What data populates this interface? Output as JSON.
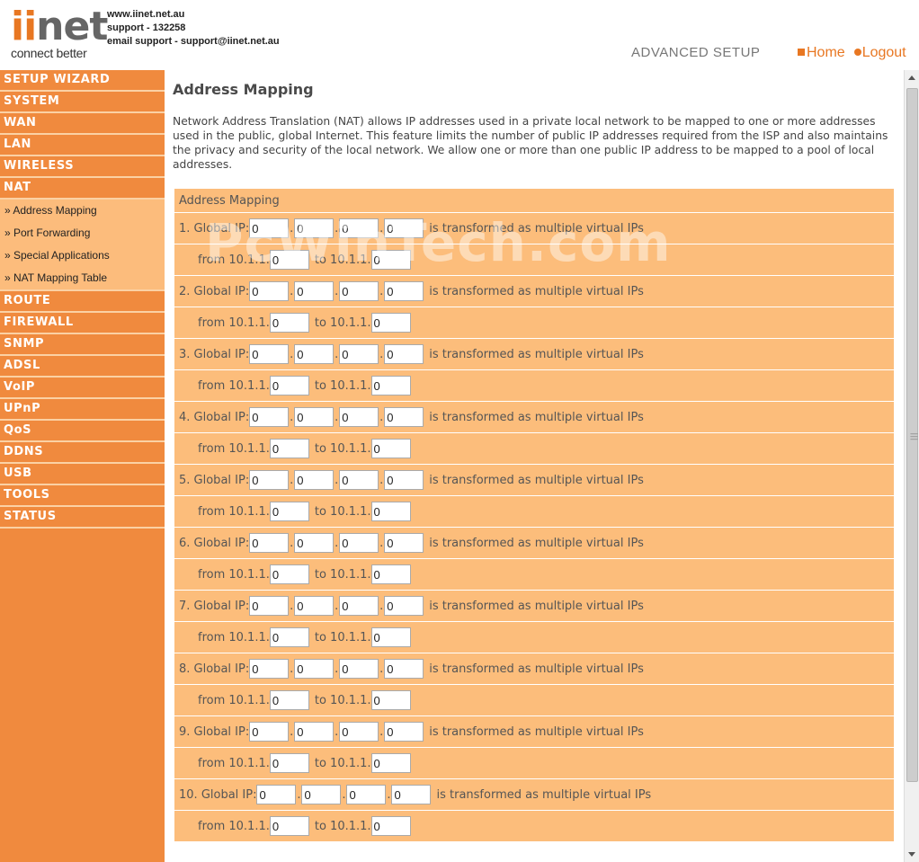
{
  "header": {
    "logo_main": "iinet",
    "logo_tagline": "connect better",
    "contact": [
      "www.iinet.net.au",
      "support - 132258",
      "email support - support@iinet.net.au"
    ],
    "section": "ADVANCED SETUP",
    "home_label": "Home",
    "logout_label": "Logout"
  },
  "sidebar": {
    "items_top": [
      "SETUP WIZARD",
      "SYSTEM",
      "WAN",
      "LAN",
      "WIRELESS",
      "NAT"
    ],
    "sub_items": [
      "» Address Mapping",
      "» Port Forwarding",
      "» Special Applications",
      "» NAT Mapping Table"
    ],
    "items_bottom": [
      "ROUTE",
      "FIREWALL",
      "SNMP",
      "ADSL",
      "VoIP",
      "UPnP",
      "QoS",
      "DDNS",
      "USB",
      "TOOLS",
      "STATUS"
    ]
  },
  "main": {
    "title": "Address Mapping",
    "description": "Network Address Translation (NAT) allows IP addresses used in a private local network to be mapped to one or more addresses used in the public, global Internet. This feature limits the number of public IP addresses required from the ISP and also maintains the privacy and security of the local network. We allow one or more than one public IP address to be mapped to a pool of local addresses.",
    "panel_title": "Address Mapping",
    "global_suffix": "Global IP:",
    "transformed_text": "is transformed as multiple virtual IPs",
    "from_label": "from 10.1.1.",
    "to_label": "to 10.1.1.",
    "mappings": [
      {
        "index": "1.",
        "global_ip": [
          "0",
          "0",
          "0",
          "0"
        ],
        "from": "0",
        "to": "0"
      },
      {
        "index": "2.",
        "global_ip": [
          "0",
          "0",
          "0",
          "0"
        ],
        "from": "0",
        "to": "0"
      },
      {
        "index": "3.",
        "global_ip": [
          "0",
          "0",
          "0",
          "0"
        ],
        "from": "0",
        "to": "0"
      },
      {
        "index": "4.",
        "global_ip": [
          "0",
          "0",
          "0",
          "0"
        ],
        "from": "0",
        "to": "0"
      },
      {
        "index": "5.",
        "global_ip": [
          "0",
          "0",
          "0",
          "0"
        ],
        "from": "0",
        "to": "0"
      },
      {
        "index": "6.",
        "global_ip": [
          "0",
          "0",
          "0",
          "0"
        ],
        "from": "0",
        "to": "0"
      },
      {
        "index": "7.",
        "global_ip": [
          "0",
          "0",
          "0",
          "0"
        ],
        "from": "0",
        "to": "0"
      },
      {
        "index": "8.",
        "global_ip": [
          "0",
          "0",
          "0",
          "0"
        ],
        "from": "0",
        "to": "0"
      },
      {
        "index": "9.",
        "global_ip": [
          "0",
          "0",
          "0",
          "0"
        ],
        "from": "0",
        "to": "0"
      },
      {
        "index": "10.",
        "global_ip": [
          "0",
          "0",
          "0",
          "0"
        ],
        "from": "0",
        "to": "0"
      }
    ]
  },
  "watermark": "PcWinTech.com",
  "colors": {
    "brand_orange": "#e87722",
    "sidebar_bg": "#f08a3e",
    "submenu_bg": "#fcbc7c",
    "panel_bg": "#fcbd7b"
  }
}
